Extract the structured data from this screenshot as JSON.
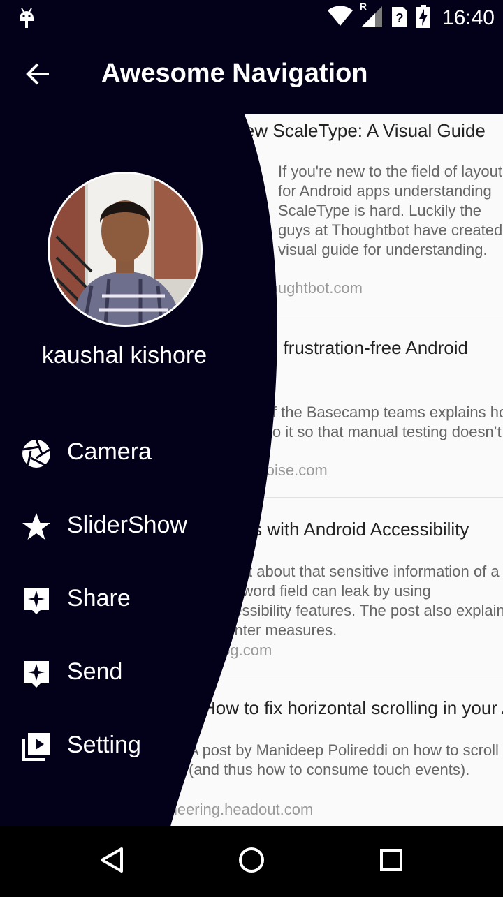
{
  "status_bar": {
    "time": "16:40",
    "network_indicator": "R"
  },
  "app_bar": {
    "title": "Awesome Navigation",
    "back_icon": "arrow-back-icon"
  },
  "drawer": {
    "user_name": "kaushal kishore",
    "items": [
      {
        "label": "Camera",
        "icon": "camera-shutter-icon"
      },
      {
        "label": "SliderShow",
        "icon": "star-icon"
      },
      {
        "label": "Share",
        "icon": "sparkle-icon"
      },
      {
        "label": "Send",
        "icon": "sparkle-icon"
      },
      {
        "label": "Setting",
        "icon": "video-library-icon"
      }
    ],
    "background_color": "#03001a"
  },
  "feed": [
    {
      "title": "ImageView ScaleType: A Visual Guide",
      "body": "If you're new to the field of layouts for Android apps understanding ScaleType is hard. Luckily the guys at Thoughtbot have created a visual guide for understanding.",
      "source": "robots.thoughtbot.com"
    },
    {
      "title": "Creating frustration-free Android",
      "body": "One of the Basecamp teams explains how they do it so that manual testing doesn’t cost",
      "source": "signalvnoise.com"
    },
    {
      "title": "Issues with Android Accessibility",
      "body": "A post about that sensitive information of a password field can leak by using accessibility features. The post also explains counter measures.",
      "source": "blog.com"
    },
    {
      "title": "How to fix horizontal scrolling in your Android app",
      "body": "A post by Manideep Polireddi on how to scroll (and thus how to consume touch events).",
      "source": "engineering.headout.com"
    }
  ],
  "nav_bar": {
    "back": "back-triangle-icon",
    "home": "home-circle-icon",
    "recents": "recents-square-icon"
  }
}
